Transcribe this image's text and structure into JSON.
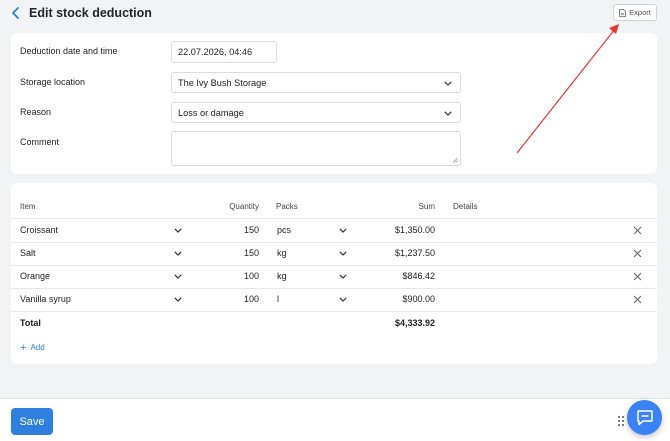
{
  "header": {
    "title": "Edit stock deduction",
    "export_label": "Export"
  },
  "form": {
    "date_label": "Deduction date and time",
    "date_value": "22.07.2026, 04:46",
    "storage_label": "Storage location",
    "storage_value": "The Ivy Bush Storage",
    "reason_label": "Reason",
    "reason_value": "Loss or damage",
    "comment_label": "Comment",
    "comment_value": ""
  },
  "table": {
    "columns": {
      "item": "Item",
      "quantity": "Quantity",
      "packs": "Packs",
      "sum": "Sum",
      "details": "Details"
    },
    "rows": [
      {
        "item": "Croissant",
        "quantity": "150",
        "packs": "pcs",
        "sum": "$1,350.00"
      },
      {
        "item": "Salt",
        "quantity": "150",
        "packs": "kg",
        "sum": "$1,237.50"
      },
      {
        "item": "Orange",
        "quantity": "100",
        "packs": "kg",
        "sum": "$846.42"
      },
      {
        "item": "Vanilla syrup",
        "quantity": "100",
        "packs": "l",
        "sum": "$900.00"
      }
    ],
    "total_label": "Total",
    "total_value": "$4,333.92",
    "add_label": "Add"
  },
  "footer": {
    "save_label": "Save"
  },
  "icons": {
    "back": "chevron-left-icon",
    "export": "document-icon",
    "chat": "chat-icon",
    "grip": "drag-grip-icon",
    "remove": "close-icon"
  },
  "colors": {
    "accent": "#2d7fe0",
    "annotation": "#e53a2b"
  }
}
